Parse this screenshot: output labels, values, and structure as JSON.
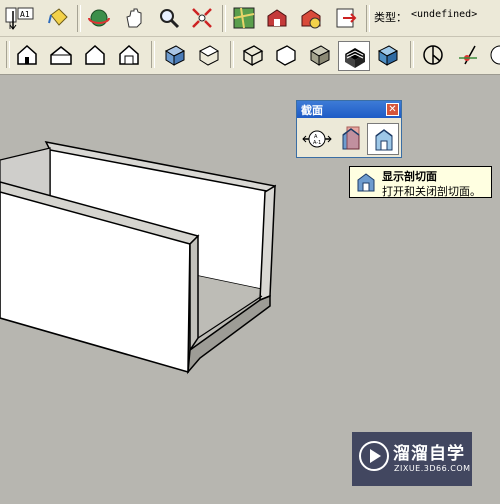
{
  "toolbar_top": {
    "type_label": "类型：",
    "type_value": "<undefined>",
    "icons": [
      "text-icon",
      "dimension-a1-icon",
      "paint-bucket-icon",
      "orbit-icon",
      "pan-hand-icon",
      "zoom-icon",
      "zoom-extents-icon",
      "map-icon",
      "3d-warehouse-icon",
      "components-icon",
      "export-icon"
    ]
  },
  "toolbar_views": {
    "icons": [
      "home-icon",
      "house-front-icon",
      "house-side-icon",
      "house-outline-icon",
      "iso-view-icon",
      "top-view-icon",
      "wireframe-icon",
      "hidden-line-icon",
      "shaded-icon",
      "shaded-textures-icon",
      "monochrome-icon",
      "axes-icon",
      "position-camera-icon",
      "walk-icon"
    ]
  },
  "section_panel": {
    "title": "截面",
    "close": "✕",
    "buttons": [
      "section-plane-icon",
      "display-section-planes-icon",
      "display-section-cut-icon"
    ]
  },
  "tooltip": {
    "title": "显示剖切面",
    "description": "打开和关闭剖切面。"
  },
  "watermark": {
    "brand": "溜溜自学",
    "url": "ZIXUE.3D66.COM"
  },
  "colors": {
    "toolbar_bg": "#ece9d8",
    "viewport_bg": "#b7b6b0",
    "panel_title": "#2a67cc",
    "tooltip_bg": "#ffffe1",
    "watermark_bg": "#282e4e"
  }
}
